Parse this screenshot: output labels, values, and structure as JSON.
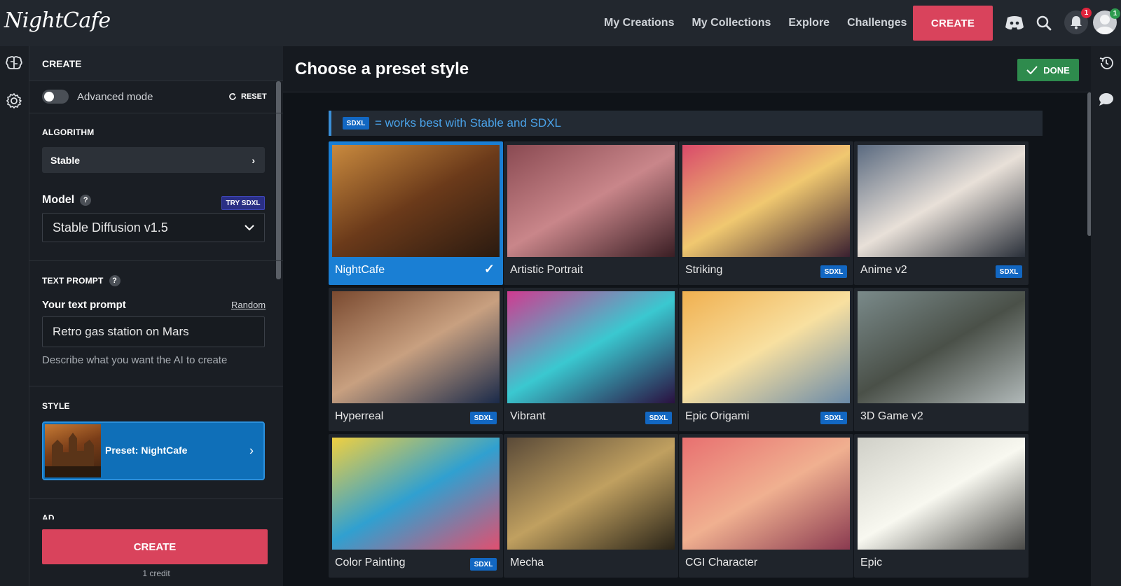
{
  "app": {
    "logo": "NightCafe"
  },
  "nav": {
    "links": [
      "My Creations",
      "My Collections",
      "Explore",
      "Challenges"
    ],
    "create_label": "CREATE",
    "notifications_count": "1",
    "profile_count": "1"
  },
  "panel": {
    "header": "CREATE",
    "advanced_mode_label": "Advanced mode",
    "advanced_mode_on": false,
    "reset_label": "RESET",
    "algorithm_title": "ALGORITHM",
    "algorithm_value": "Stable",
    "model_label": "Model",
    "try_sdxl_label": "TRY SDXL",
    "model_value": "Stable Diffusion v1.5",
    "text_prompt_title": "TEXT PROMPT",
    "your_prompt_label": "Your text prompt",
    "random_label": "Random",
    "prompt_value": "Retro gas station on Mars",
    "prompt_hint": "Describe what you want the AI to create",
    "style_title": "STYLE",
    "style_value": "Preset: NightCafe",
    "ad_title": "AD",
    "create_label": "CREATE",
    "credit_text": "1 credit"
  },
  "main": {
    "title": "Choose a preset style",
    "done_label": "DONE",
    "info_badge": "SDXL",
    "info_text": "= works best with Stable and SDXL",
    "styles": [
      {
        "name": "NightCafe",
        "sdxl": false,
        "selected": true,
        "colors": [
          "#c98a3e",
          "#6b3a1a",
          "#2a1a10"
        ]
      },
      {
        "name": "Artistic Portrait",
        "sdxl": false,
        "selected": false,
        "colors": [
          "#8a4a52",
          "#c9868a",
          "#3a1e24"
        ]
      },
      {
        "name": "Striking",
        "sdxl": true,
        "selected": false,
        "colors": [
          "#d94a6a",
          "#f0c870",
          "#3a2030"
        ]
      },
      {
        "name": "Anime v2",
        "sdxl": true,
        "selected": false,
        "colors": [
          "#5a6a80",
          "#e8e0d8",
          "#2a303a"
        ]
      },
      {
        "name": "Hyperreal",
        "sdxl": true,
        "selected": false,
        "colors": [
          "#7a4a30",
          "#c8a080",
          "#1a2a4a"
        ]
      },
      {
        "name": "Vibrant",
        "sdxl": true,
        "selected": false,
        "colors": [
          "#d03a90",
          "#3ac8d0",
          "#2a1040"
        ]
      },
      {
        "name": "Epic Origami",
        "sdxl": true,
        "selected": false,
        "colors": [
          "#f0b050",
          "#f8e0a0",
          "#6a8aa8"
        ]
      },
      {
        "name": "3D Game v2",
        "sdxl": false,
        "selected": false,
        "colors": [
          "#7a8a8a",
          "#4a5048",
          "#b0b8b8"
        ]
      },
      {
        "name": "Color Painting",
        "sdxl": true,
        "selected": false,
        "colors": [
          "#f0d040",
          "#30a0d0",
          "#e05070"
        ]
      },
      {
        "name": "Mecha",
        "sdxl": false,
        "selected": false,
        "colors": [
          "#5a4a38",
          "#c0a060",
          "#2a2418"
        ]
      },
      {
        "name": "CGI Character",
        "sdxl": false,
        "selected": false,
        "colors": [
          "#e87070",
          "#f0b090",
          "#8a3a50"
        ]
      },
      {
        "name": "Epic",
        "sdxl": false,
        "selected": false,
        "colors": [
          "#d0d0c8",
          "#f8f8f0",
          "#4a4a48"
        ]
      }
    ]
  },
  "colors": {
    "accent": "#d9435c",
    "primary_blue": "#1a7fd4",
    "done_green": "#2e8b4d"
  }
}
